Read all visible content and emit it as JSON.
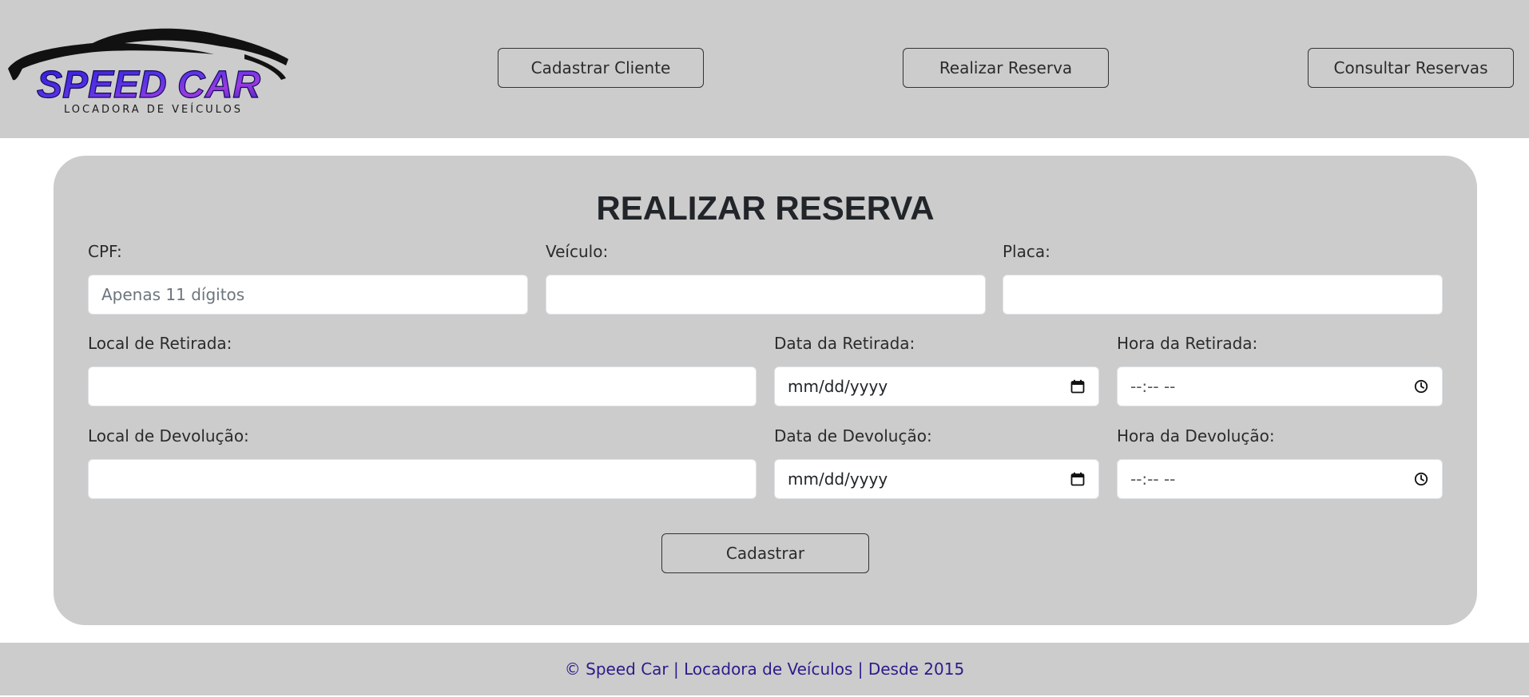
{
  "brand": {
    "name": "SPEED CAR",
    "tagline": "LOCADORA DE VEÍCULOS",
    "colors": {
      "primary": "#2a1bd6",
      "accent": "#7a2bd8",
      "car_outline": "#111111"
    }
  },
  "nav": {
    "cadastrar_cliente": "Cadastrar Cliente",
    "realizar_reserva": "Realizar Reserva",
    "consultar_reservas": "Consultar Reservas"
  },
  "form": {
    "title": "REALIZAR RESERVA",
    "cpf": {
      "label": "CPF:",
      "placeholder": "Apenas 11 dígitos",
      "value": ""
    },
    "veiculo": {
      "label": "Veículo:",
      "value": ""
    },
    "placa": {
      "label": "Placa:",
      "value": ""
    },
    "local_retirada": {
      "label": "Local de Retirada:",
      "value": ""
    },
    "data_retirada": {
      "label": "Data da Retirada:",
      "value": "mm/dd/yyyy"
    },
    "hora_retirada": {
      "label": "Hora da Retirada:",
      "value": "--:-- --"
    },
    "local_devolucao": {
      "label": "Local de Devolução:",
      "value": ""
    },
    "data_devolucao": {
      "label": "Data de Devolução:",
      "value": "mm/dd/yyyy"
    },
    "hora_devolucao": {
      "label": "Hora da Devolução:",
      "value": "--:-- --"
    },
    "submit_label": "Cadastrar"
  },
  "footer": {
    "text": "© Speed Car | Locadora de Veículos | Desde 2015",
    "color": "#2d1b8a"
  },
  "icons": {
    "date": "calendar-icon",
    "time": "clock-icon"
  }
}
